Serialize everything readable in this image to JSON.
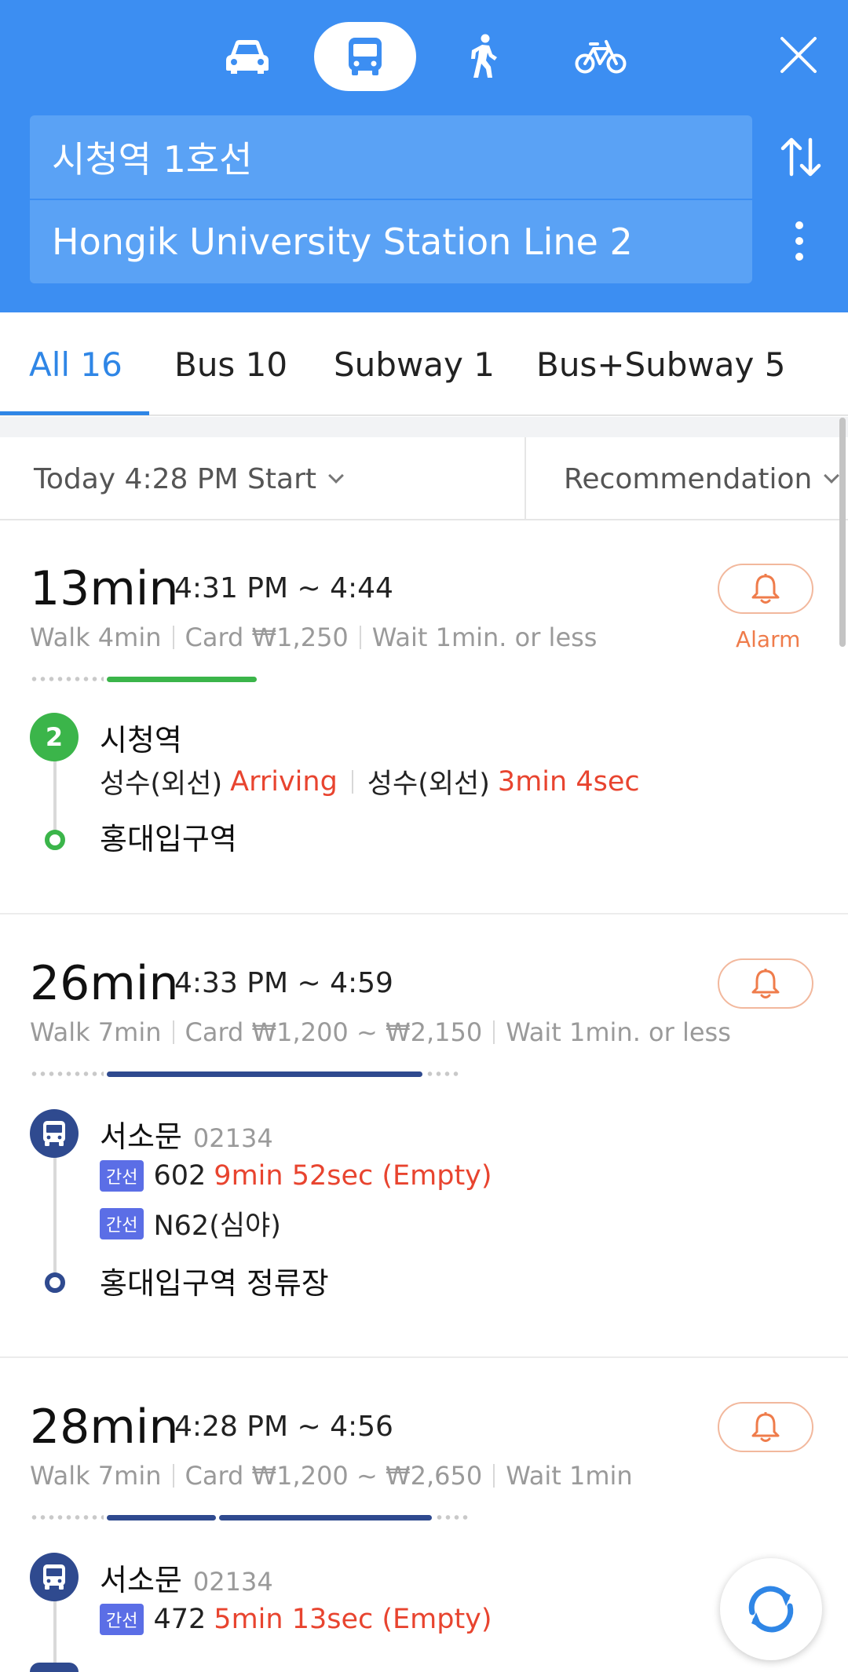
{
  "header": {
    "modes": [
      {
        "name": "car",
        "icon": "car-icon",
        "selected": false
      },
      {
        "name": "transit",
        "icon": "bus-icon",
        "selected": true
      },
      {
        "name": "walk",
        "icon": "walk-icon",
        "selected": false
      },
      {
        "name": "bike",
        "icon": "bike-icon",
        "selected": false
      }
    ],
    "origin": "시청역 1호선",
    "destination": "Hongik University Station Line 2",
    "accent_color": "#3c8ef2"
  },
  "tabs": [
    {
      "label": "All 16",
      "active": true
    },
    {
      "label": "Bus 10",
      "active": false
    },
    {
      "label": "Subway 1",
      "active": false
    },
    {
      "label": "Bus+Subway 5",
      "active": false
    }
  ],
  "filter": {
    "start_label": "Today 4:28 PM Start",
    "sort_label": "Recommendation"
  },
  "routes": [
    {
      "duration": "13min",
      "time": "4:31 PM ~ 4:44",
      "walk": "Walk 4min",
      "fare": "Card ₩1,250",
      "wait": "Wait 1min. or less",
      "alarm_label": "Alarm",
      "line_color": "#3bb54a",
      "badge": "2",
      "board_stop": "시청역",
      "arrivals": [
        {
          "dest": "성수(외선)",
          "status": "Arriving"
        },
        {
          "dest": "성수(외선)",
          "status": "3min 4sec"
        }
      ],
      "alight_stop": "홍대입구역"
    },
    {
      "duration": "26min",
      "time": "4:33 PM ~ 4:59",
      "walk": "Walk 7min",
      "fare": "Card ₩1,200 ~ ₩2,150",
      "wait": "Wait 1min. or less",
      "line_color": "#2f4a8f",
      "board_stop": "서소문",
      "board_code": "02134",
      "buses": [
        {
          "type": "간선",
          "number": "602",
          "status": "9min 52sec (Empty)"
        },
        {
          "type": "간선",
          "number": "N62(심야)",
          "status": ""
        }
      ],
      "alight_stop": "홍대입구역 정류장"
    },
    {
      "duration": "28min",
      "time": "4:28 PM ~ 4:56",
      "walk": "Walk 7min",
      "fare": "Card ₩1,200 ~ ₩2,650",
      "wait": "Wait 1min",
      "line_color": "#2f4a8f",
      "board_stop": "서소문",
      "board_code": "02134",
      "buses": [
        {
          "type": "간선",
          "number": "472",
          "status": "5min 13sec (Empty)"
        }
      ]
    }
  ],
  "fab": {
    "icon": "refresh-icon"
  }
}
